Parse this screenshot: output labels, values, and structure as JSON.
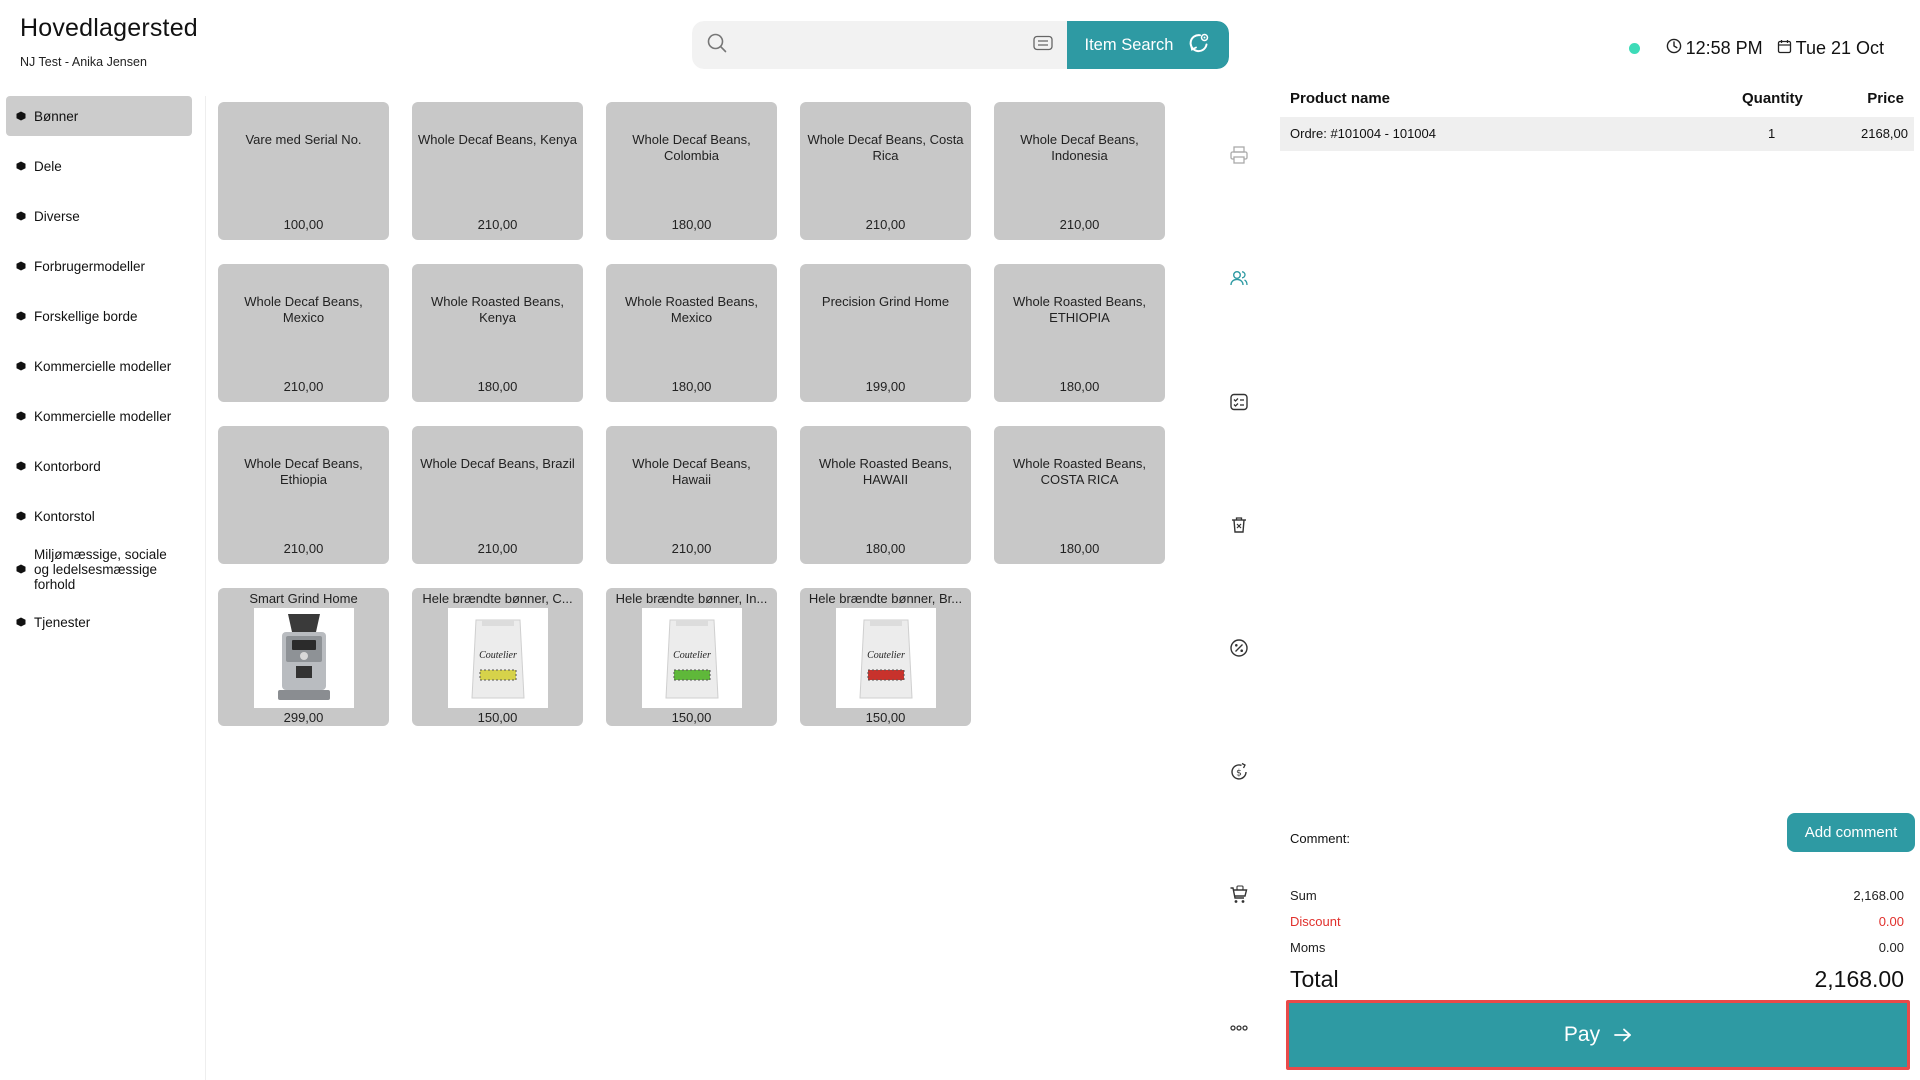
{
  "header": {
    "store": "Hovedlagersted",
    "user": "NJ Test - Anika Jensen"
  },
  "search": {
    "placeholder": "",
    "button_label": "Item Search"
  },
  "status": {
    "time": "12:58 PM",
    "date": "Tue 21 Oct",
    "online_color": "#3ddbb8"
  },
  "categories": [
    {
      "label": "Bønner",
      "active": true
    },
    {
      "label": "Dele"
    },
    {
      "label": "Diverse"
    },
    {
      "label": "Forbrugermodeller"
    },
    {
      "label": "Forskellige borde"
    },
    {
      "label": "Kommercielle modeller"
    },
    {
      "label": "Kommercielle modeller"
    },
    {
      "label": "Kontorbord"
    },
    {
      "label": "Kontorstol"
    },
    {
      "label": "Miljømæssige, sociale og ledelsesmæssige forhold"
    },
    {
      "label": "Tjenester"
    }
  ],
  "products": [
    {
      "name": "Vare med Serial No.",
      "price": "100,00"
    },
    {
      "name": "Whole Decaf Beans, Kenya",
      "price": "210,00"
    },
    {
      "name": "Whole Decaf Beans, Colombia",
      "price": "180,00"
    },
    {
      "name": "Whole Decaf Beans, Costa Rica",
      "price": "210,00"
    },
    {
      "name": "Whole Decaf Beans, Indonesia",
      "price": "210,00"
    },
    {
      "name": "Whole Decaf Beans, Mexico",
      "price": "210,00"
    },
    {
      "name": "Whole Roasted Beans, Kenya",
      "price": "180,00"
    },
    {
      "name": "Whole Roasted Beans, Mexico",
      "price": "180,00"
    },
    {
      "name": "Precision Grind Home",
      "price": "199,00"
    },
    {
      "name": "Whole Roasted Beans, ETHIOPIA",
      "price": "180,00"
    },
    {
      "name": "Whole Decaf Beans, Ethiopia",
      "price": "210,00"
    },
    {
      "name": "Whole Decaf Beans, Brazil",
      "price": "210,00"
    },
    {
      "name": "Whole Decaf Beans, Hawaii",
      "price": "210,00"
    },
    {
      "name": "Whole Roasted Beans, HAWAII",
      "price": "180,00"
    },
    {
      "name": "Whole Roasted Beans, COSTA RICA",
      "price": "180,00"
    },
    {
      "name": "Smart Grind Home",
      "price": "299,00",
      "image": "grinder"
    },
    {
      "name": "Hele brændte bønner, C...",
      "price": "150,00",
      "image": "bag",
      "band": "#d6d24a"
    },
    {
      "name": "Hele brændte bønner, In...",
      "price": "150,00",
      "image": "bag",
      "band": "#5fb83a"
    },
    {
      "name": "Hele brændte bønner, Br...",
      "price": "150,00",
      "image": "bag",
      "band": "#c8322c"
    }
  ],
  "bag_brand": "Coutelier",
  "actions": [
    "printer-icon",
    "customer-icon",
    "checklist-icon",
    "trash-icon",
    "percent-icon",
    "cash-refresh-icon",
    "cart-icon",
    "more-icon"
  ],
  "order": {
    "columns": {
      "name": "Product name",
      "qty": "Quantity",
      "price": "Price"
    },
    "rows": [
      {
        "name": "Ordre: #101004 - 101004",
        "qty": "1",
        "price": "2168,00"
      }
    ]
  },
  "comment": {
    "label": "Comment:",
    "button_label": "Add comment"
  },
  "summary": {
    "sum_label": "Sum",
    "sum": "2,168.00",
    "discount_label": "Discount",
    "discount": "0.00",
    "moms_label": "Moms",
    "moms": "0.00",
    "total_label": "Total",
    "total": "2,168.00"
  },
  "pay": {
    "label": "Pay"
  },
  "colors": {
    "accent": "#2e9aa3",
    "tile": "#c8c8c8",
    "discount": "#e0302c",
    "highlight": "#e84a4a"
  }
}
